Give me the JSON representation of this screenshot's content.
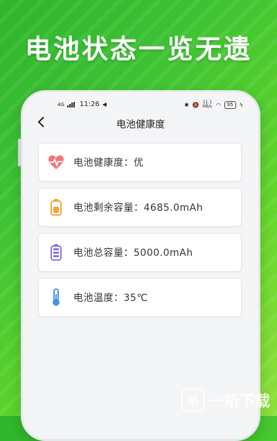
{
  "banner": {
    "headline": "电池状态一览无遗"
  },
  "status_bar": {
    "time": "11:26",
    "network": "4G",
    "speed": "11.1 KB/s",
    "battery": "95"
  },
  "nav": {
    "back_icon": "chevron-left-icon",
    "title": "电池健康度"
  },
  "items": [
    {
      "icon": "heart-pulse-icon",
      "label": "电池健康度：优",
      "color": "#f07a7a"
    },
    {
      "icon": "battery-orange-icon",
      "label": "电池剩余容量：4685.0mAh",
      "color": "#f5a43a"
    },
    {
      "icon": "battery-purple-icon",
      "label": "电池总容量：5000.0mAh",
      "color": "#8a78e6"
    },
    {
      "icon": "thermometer-icon",
      "label": "电池温度：35℃",
      "color": "#4a8fe8"
    }
  ],
  "watermark": {
    "logo_text": "听",
    "text": "一听下载"
  }
}
